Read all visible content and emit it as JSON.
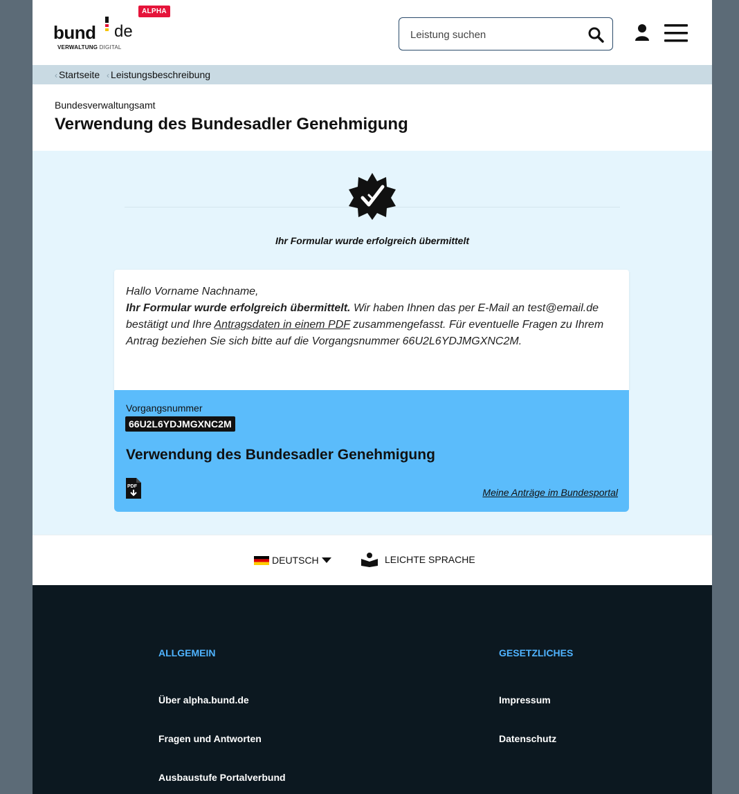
{
  "header": {
    "alpha_badge": "ALPHA",
    "logo_bund": "bund",
    "logo_de": "de",
    "logo_sub_bold": "VERWALTUNG",
    "logo_sub_light": "DIGITAL",
    "search_placeholder": "Leistung suchen",
    "icons": [
      "search-icon",
      "user-icon",
      "menu-icon"
    ]
  },
  "breadcrumb": [
    "Startseite",
    "Leistungsbeschreibung"
  ],
  "agency": "Bundesverwaltungsamt",
  "title": "Verwendung des Bundesadler Genehmigung",
  "confirmation": {
    "heading": "Ihr Formular wurde erfolgreich übermittelt",
    "greeting": "Hallo Vorname Nachname,",
    "bold_sentence": "Ihr Formular wurde erfolgreich übermittelt.",
    "text_part1": " Wir haben Ihnen das per E-Mail an test@email.de bestätigt und Ihre ",
    "link_text": "Antragsdaten in einem PDF",
    "text_part2": " zusammengefasst. Für eventuelle Fragen zu Ihrem Antrag beziehen Sie sich bitte auf die Vorgangsnummer 66U2L6YDJMGXNC2M."
  },
  "info_card": {
    "vorgang_label": "Vorgangsnummer",
    "vorgang_number": "66U2L6YDJMGXNC2M",
    "title": "Verwendung des Bundesadler Genehmigung",
    "pdf_icon_label": "PDF",
    "portal_link": "Meine Anträge im Bundesportal"
  },
  "language": {
    "current": "DEUTSCH",
    "easy_language": "LEICHTE SPRACHE"
  },
  "footer": {
    "col1_heading": "ALLGEMEIN",
    "col1_links": [
      "Über alpha.bund.de",
      "Fragen und Antworten",
      "Ausbaustufe Portalverbund"
    ],
    "col2_heading": "GESETZLICHES",
    "col2_links": [
      "Impressum",
      "Datenschutz"
    ]
  },
  "colors": {
    "badge_red": "#e5143a",
    "confirm_bg": "#e5f5fd",
    "info_card_blue": "#5bbcfb",
    "footer_bg": "#0c1820",
    "footer_heading": "#4fb3ff"
  }
}
